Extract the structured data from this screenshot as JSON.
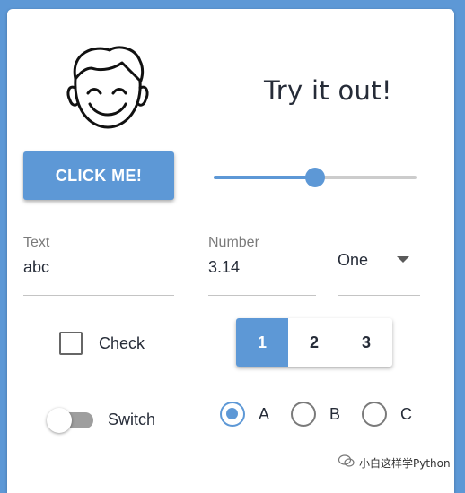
{
  "header": {
    "title": "Try it out!"
  },
  "avatar": {
    "icon": "smiling-face-icon"
  },
  "button": {
    "label": "CLICK ME!"
  },
  "slider": {
    "value": 0.5
  },
  "text_field": {
    "label": "Text",
    "value": "abc"
  },
  "number_field": {
    "label": "Number",
    "value": "3.14"
  },
  "select": {
    "value": "One"
  },
  "checkbox": {
    "label": "Check",
    "checked": false
  },
  "segmented": {
    "options": [
      "1",
      "2",
      "3"
    ],
    "selected": "1"
  },
  "switch": {
    "label": "Switch",
    "on": false
  },
  "radios": {
    "options": [
      "A",
      "B",
      "C"
    ],
    "selected": "A"
  },
  "watermark": {
    "text": "小白这样学Python"
  },
  "colors": {
    "accent": "#5d98d6",
    "background": "#5d98d6",
    "text": "#262c38"
  }
}
